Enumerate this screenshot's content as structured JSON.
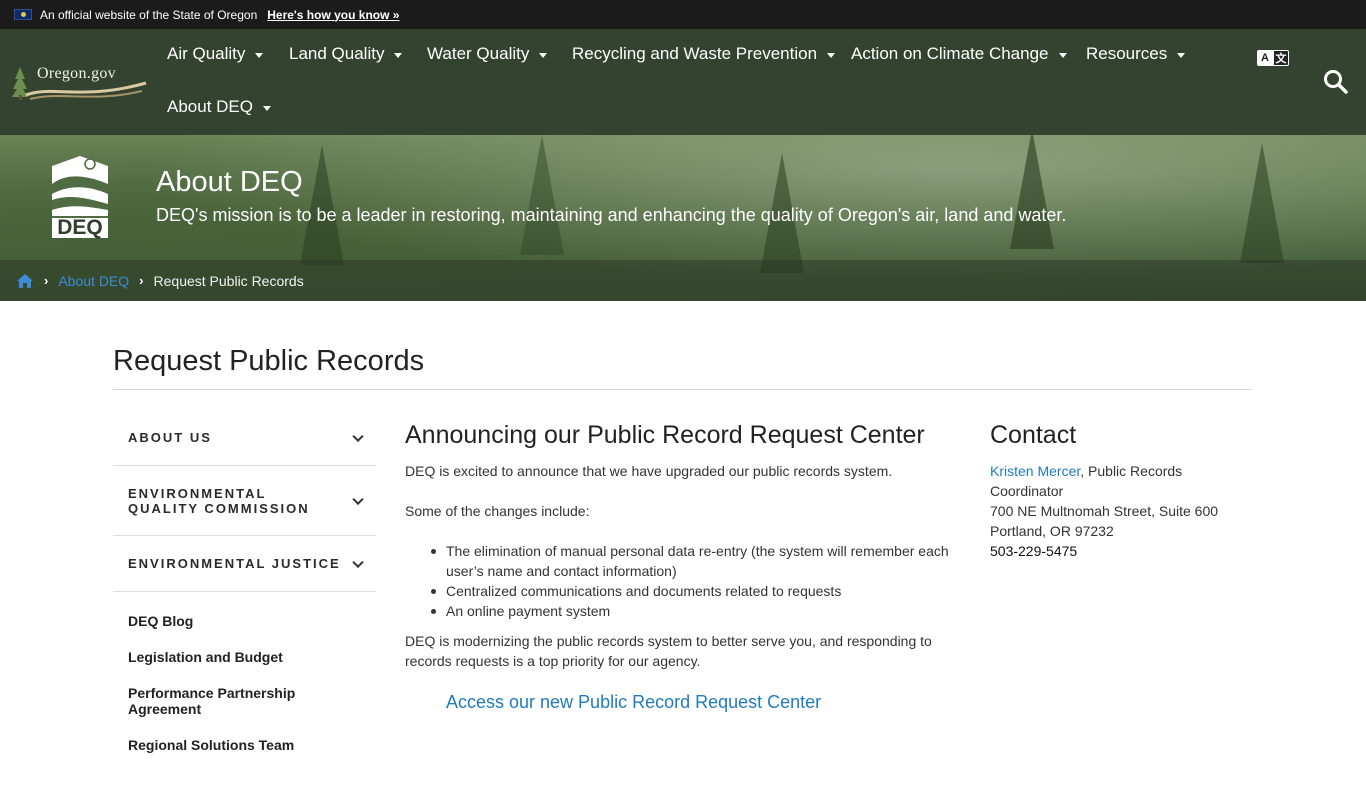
{
  "official_banner": {
    "text": "An official website of the State of Oregon",
    "link": "Here's how you know »"
  },
  "logo": {
    "text": "Oregon.gov"
  },
  "nav": {
    "items": [
      {
        "label": "Air Quality"
      },
      {
        "label": "Land Quality"
      },
      {
        "label": "Water Quality"
      },
      {
        "label": "Recycling and Waste Prevention"
      },
      {
        "label": "Action on Climate Change"
      },
      {
        "label": "Resources"
      },
      {
        "label": "About DEQ"
      }
    ],
    "translate": {
      "a": "A",
      "b": "文"
    }
  },
  "hero": {
    "logo_text": "DEQ",
    "title": "About DEQ",
    "mission": "DEQ's mission is to be a leader in restoring, maintaining and enhancing the quality of Oregon's air, land and water."
  },
  "breadcrumb": {
    "items": [
      {
        "label": "About DEQ"
      },
      {
        "label": "Request Public Records"
      }
    ]
  },
  "page": {
    "title": "Request Public Records"
  },
  "sidebar": {
    "accordions": [
      {
        "label": "ABOUT US"
      },
      {
        "label": "ENVIRONMENTAL QUALITY COMMISSION"
      },
      {
        "label": "ENVIRONMENTAL JUSTICE"
      }
    ],
    "links": [
      {
        "label": "DEQ Blog"
      },
      {
        "label": "Legislation and Budget"
      },
      {
        "label": "Performance Partnership Agreement"
      },
      {
        "label": "Regional Solutions Team"
      }
    ]
  },
  "main": {
    "heading": "Announcing our Public Record Request Center",
    "intro": "DEQ is excited to announce that we have upgraded our public records system.",
    "changes_intro": "Some of the changes include:",
    "bullets": [
      "The elimination of manual personal data re-entry (the system will remember each user’s name and contact information)",
      "Centralized communications and documents related to requests",
      "An online payment system"
    ],
    "closing": "DEQ is modernizing the public records system to better serve you, and responding to records requests is a top priority for our agency.",
    "access_link": "Access our new Public Record Request Center"
  },
  "contact": {
    "heading": "Contact",
    "name": "Kristen Mercer",
    "role": ", Public Records Coordinator",
    "address1": "700 NE Multnomah Street, Suite 600",
    "address2": "Portland, OR 97232",
    "phone": "503-229-5475"
  }
}
